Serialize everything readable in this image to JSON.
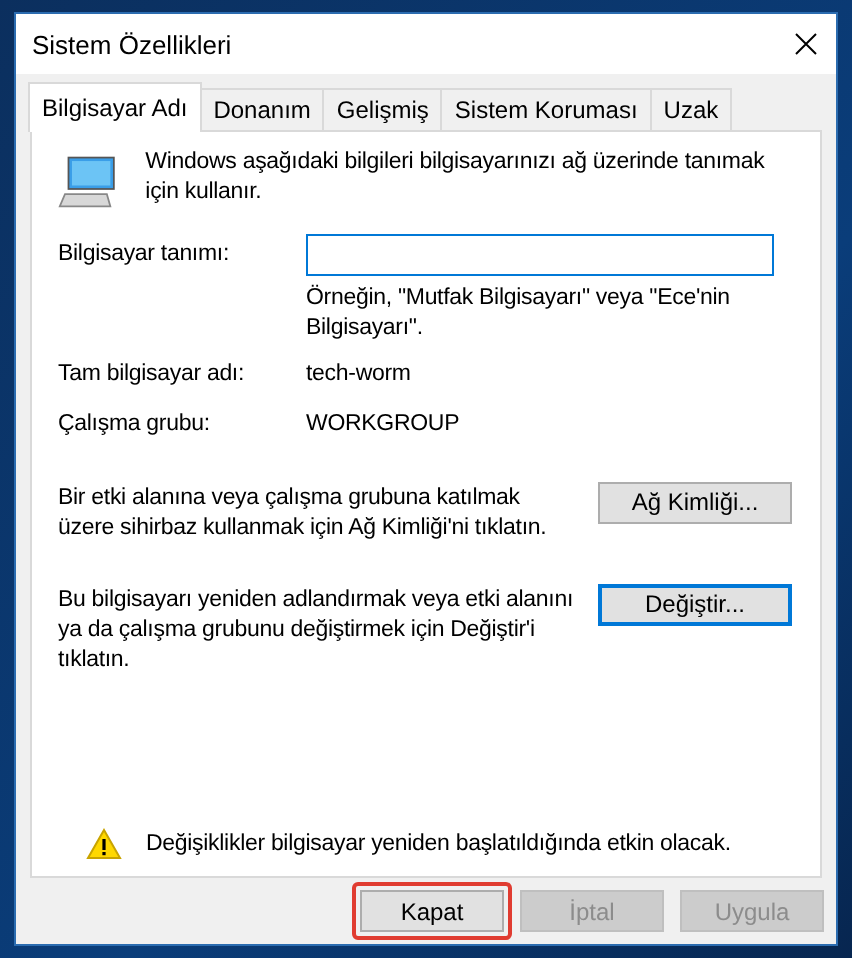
{
  "window": {
    "title": "Sistem Özellikleri"
  },
  "tabs": [
    {
      "label": "Bilgisayar Adı",
      "selected": true
    },
    {
      "label": "Donanım",
      "selected": false
    },
    {
      "label": "Gelişmiş",
      "selected": false
    },
    {
      "label": "Sistem Koruması",
      "selected": false
    },
    {
      "label": "Uzak",
      "selected": false
    }
  ],
  "intro": "Windows aşağıdaki bilgileri bilgisayarınızı ağ üzerinde tanımak için kullanır.",
  "description": {
    "label": "Bilgisayar tanımı:",
    "hint": "Örneğin, \"Mutfak Bilgisayarı\" veya \"Ece'nin Bilgisayarı\"."
  },
  "info": [
    {
      "label": "Tam bilgisayar adı:",
      "value": "tech-worm"
    },
    {
      "label": "Çalışma grubu:",
      "value": "WORKGROUP"
    }
  ],
  "actions": [
    {
      "text": "Bir etki alanına veya çalışma grubuna katılmak üzere sihirbaz kullanmak için Ağ Kimliği'ni tıklatın.",
      "button": "Ağ Kimliği...",
      "focused": false
    },
    {
      "text": "Bu bilgisayarı yeniden adlandırmak veya etki alanını ya da çalışma grubunu değiştirmek için Değiştir'i tıklatın.",
      "button": "Değiştir...",
      "focused": true
    }
  ],
  "warning": "Değişiklikler bilgisayar yeniden  başlatıldığında etkin olacak.",
  "buttons": [
    {
      "label": "Kapat",
      "disabled": false,
      "highlighted": true
    },
    {
      "label": "İptal",
      "disabled": true,
      "highlighted": false
    },
    {
      "label": "Uygula",
      "disabled": true,
      "highlighted": false
    }
  ]
}
